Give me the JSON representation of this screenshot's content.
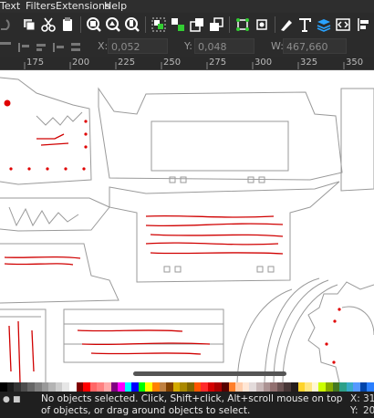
{
  "menu": [
    "Text",
    "Filters",
    "Extensions",
    "Help"
  ],
  "controls": {
    "x_label": "X:",
    "x_value": "0,052",
    "y_label": "Y:",
    "y_value": "0,048",
    "w_label": "W:",
    "w_value": "467,660"
  },
  "ruler": [
    "175",
    "200",
    "225",
    "250",
    "275",
    "300",
    "325",
    "350"
  ],
  "palette": [
    "#000000",
    "#1a1a1a",
    "#333333",
    "#4d4d4d",
    "#666666",
    "#808080",
    "#999999",
    "#b3b3b3",
    "#cccccc",
    "#e6e6e6",
    "#ffffff",
    "#800000",
    "#ff0000",
    "#ff6666",
    "#ff8080",
    "#ffaaaa",
    "#800080",
    "#ff00ff",
    "#00ffff",
    "#0000ff",
    "#00ff00",
    "#ffff00",
    "#ff8000",
    "#c08040",
    "#804000",
    "#d4aa00",
    "#aa8800",
    "#806600",
    "#ff5500",
    "#ff2a2a",
    "#d40000",
    "#aa0000",
    "#550000",
    "#ff7f2a",
    "#ffccaa",
    "#ffe6d5",
    "#e3dbdb",
    "#c8b7b7",
    "#ac9393",
    "#916f6f",
    "#6c5353",
    "#483737",
    "#241c1c",
    "#ffd42a",
    "#ffe680",
    "#fff6d5",
    "#ccff00",
    "#88aa00",
    "#447821",
    "#2ca089",
    "#37abc8",
    "#5599ff",
    "#0044aa",
    "#2a7fff"
  ],
  "status": {
    "message": "No objects selected. Click, Shift+click, Alt+scroll mouse on top of objects, or drag around objects to select.",
    "x_label": "X:",
    "x_value": "31",
    "y_label": "Y:",
    "y_value": "20"
  },
  "icons": [
    "undo-icon",
    "copy-icon",
    "cut-icon",
    "paste-icon",
    "zoom-selection-icon",
    "zoom-drawing-icon",
    "zoom-page-icon",
    "group-icon",
    "ungroup-icon",
    "raise-icon",
    "lower-icon",
    "snap-bbox-icon",
    "snap-nodes-icon",
    "fill-stroke-icon",
    "text-icon",
    "layers-icon",
    "xml-editor-icon",
    "align-icon"
  ]
}
